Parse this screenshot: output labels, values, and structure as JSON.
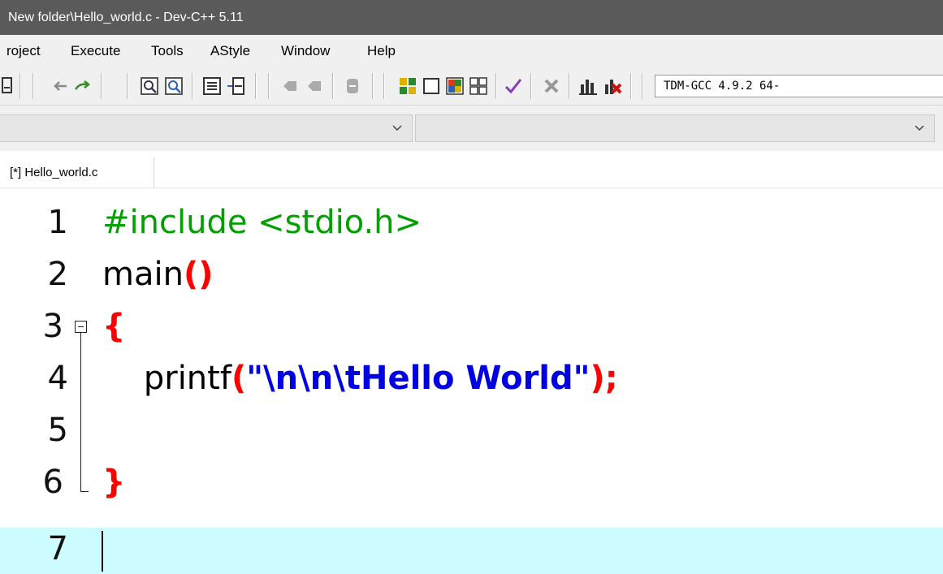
{
  "window": {
    "title": "New folder\\Hello_world.c - Dev-C++ 5.11"
  },
  "menu": {
    "items": [
      "roject",
      "Execute",
      "Tools",
      "AStyle",
      "Window",
      "Help"
    ]
  },
  "toolbar": {
    "icons": [
      "save-all-icon",
      "undo-icon",
      "redo-icon",
      "find-icon",
      "replace-icon",
      "indent-icon",
      "unindent-icon",
      "toggle-bookmark-icon",
      "goto-bookmark-icon",
      "comment-icon",
      "compile-icon",
      "run-icon",
      "compile-run-icon",
      "rebuild-icon",
      "check-syntax-icon",
      "stop-icon",
      "profile-icon",
      "delete-profile-icon"
    ],
    "compiler": "TDM-GCC 4.9.2 64-"
  },
  "tabs": [
    {
      "label": "[*] Hello_world.c"
    }
  ],
  "editor": {
    "lines": [
      {
        "number": "1",
        "tokens": [
          {
            "text": "#include <stdio.h>",
            "kind": "pre"
          }
        ]
      },
      {
        "number": "2",
        "tokens": [
          {
            "text": "main",
            "kind": "plain"
          },
          {
            "text": "()",
            "kind": "sym"
          }
        ]
      },
      {
        "number": "3",
        "tokens": [
          {
            "text": "{",
            "kind": "sym"
          }
        ]
      },
      {
        "number": "4",
        "tokens": [
          {
            "text": "    printf",
            "kind": "plain"
          },
          {
            "text": "(",
            "kind": "sym"
          },
          {
            "text": "\"\\n\\n\\tHello World\"",
            "kind": "str"
          },
          {
            "text": ");",
            "kind": "sym"
          }
        ]
      },
      {
        "number": "5",
        "tokens": []
      },
      {
        "number": "6",
        "tokens": [
          {
            "text": "}",
            "kind": "sym"
          }
        ]
      },
      {
        "number": "7",
        "tokens": []
      }
    ],
    "current_line": "7",
    "colors": {
      "preprocessor": "#00a000",
      "string": "#0000e0",
      "symbol": "#ff0000",
      "current_line_bg": "#ccfcff"
    }
  }
}
